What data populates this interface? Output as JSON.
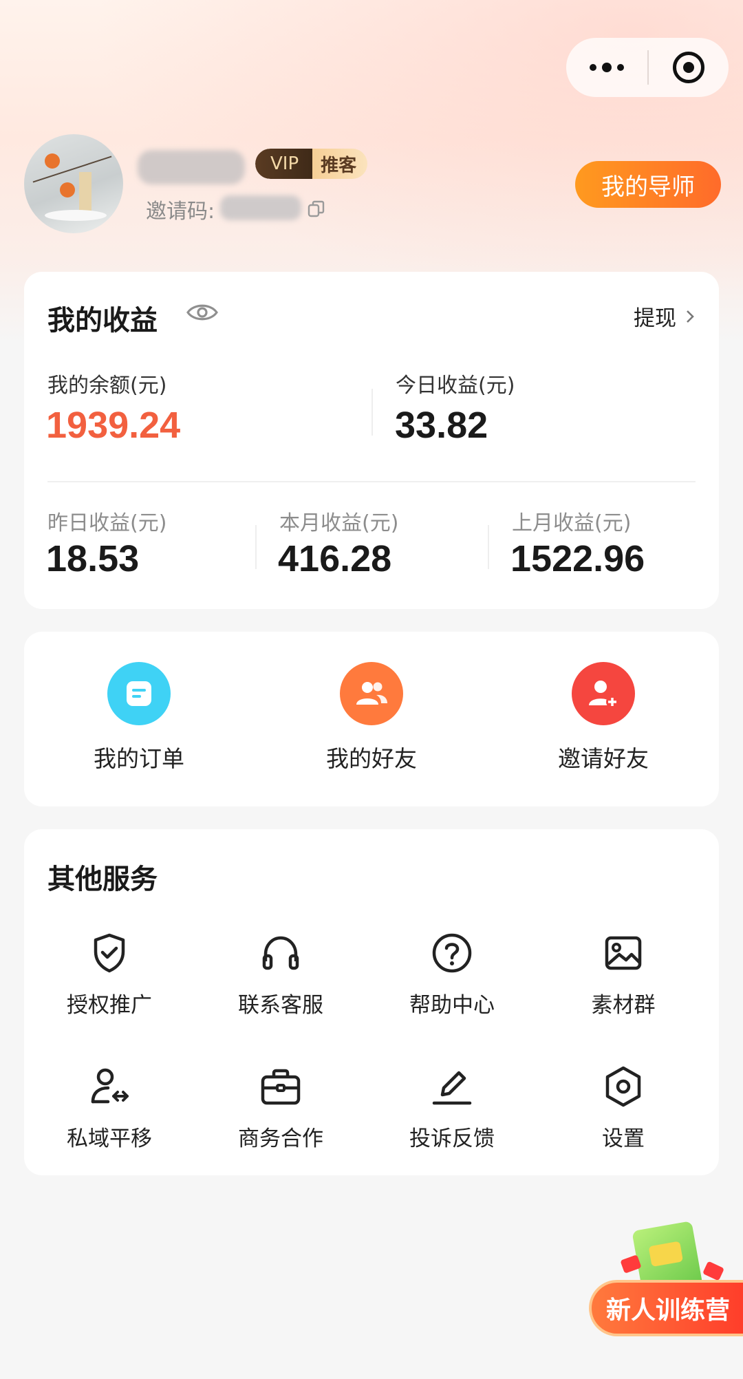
{
  "header": {
    "vip_label": "VIP",
    "role_label": "推客",
    "invite_label": "邀请码:",
    "mentor_button": "我的导师"
  },
  "earnings": {
    "title": "我的收益",
    "withdraw_label": "提现",
    "balance_label": "我的余额(元)",
    "balance_value": "1939.24",
    "today_label": "今日收益(元)",
    "today_value": "33.82",
    "yesterday_label": "昨日收益(元)",
    "yesterday_value": "18.53",
    "month_label": "本月收益(元)",
    "month_value": "416.28",
    "last_month_label": "上月收益(元)",
    "last_month_value": "1522.96"
  },
  "quick_actions": [
    {
      "label": "我的订单",
      "icon": "order-icon",
      "color": "#3fd2f5"
    },
    {
      "label": "我的好友",
      "icon": "friends-icon",
      "color": "#ff7a3d"
    },
    {
      "label": "邀请好友",
      "icon": "add-friend-icon",
      "color": "#f5463f"
    }
  ],
  "services": {
    "title": "其他服务",
    "items": [
      {
        "label": "授权推广",
        "icon": "shield-check-icon"
      },
      {
        "label": "联系客服",
        "icon": "headphones-icon"
      },
      {
        "label": "帮助中心",
        "icon": "help-icon"
      },
      {
        "label": "素材群",
        "icon": "image-icon"
      },
      {
        "label": "私域平移",
        "icon": "user-transfer-icon"
      },
      {
        "label": "商务合作",
        "icon": "briefcase-icon"
      },
      {
        "label": "投诉反馈",
        "icon": "edit-icon"
      },
      {
        "label": "设置",
        "icon": "settings-icon"
      }
    ]
  },
  "floating": {
    "label": "新人训练营"
  },
  "colors": {
    "accent_red": "#f2603f",
    "mentor_gradient_start": "#ff9a1f",
    "mentor_gradient_end": "#ff6b2a"
  }
}
